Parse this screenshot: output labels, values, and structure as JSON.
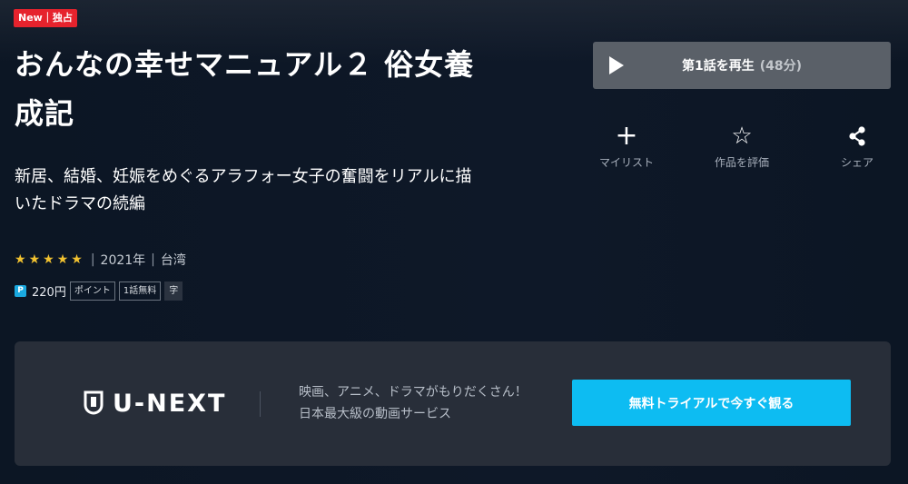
{
  "badge": "New｜独占",
  "title": "おんなの幸せマニュアル２ 俗女養成記",
  "description": "新居、結婚、妊娠をめぐるアラフォー女子の奮闘をリアルに描いたドラマの続編",
  "rating": {
    "stars": 5,
    "max": 5,
    "star_glyph": "★"
  },
  "meta": {
    "year": "2021年",
    "country": "台湾",
    "separator": "|"
  },
  "price": {
    "icon_label": "P",
    "amount": "220円",
    "chips": [
      "ポイント",
      "1話無料",
      "字"
    ]
  },
  "play_button": {
    "label": "第1話を再生",
    "duration": "(48分)",
    "icon": "play-icon"
  },
  "actions": [
    {
      "label": "マイリスト",
      "icon": "plus-icon"
    },
    {
      "label": "作品を評価",
      "icon": "star-outline-icon"
    },
    {
      "label": "シェア",
      "icon": "share-icon"
    }
  ],
  "promo": {
    "logo_text": "U-NEXT",
    "line1": "映画、アニメ、ドラマがもりだくさん！",
    "line2": "日本最大級の動画サービス",
    "cta": "無料トライアルで今すぐ観る"
  },
  "colors": {
    "background": "#0c1624",
    "badge": "#e6232d",
    "star": "#f2c230",
    "cta": "#0dbcf2",
    "play_button": "#5a6068",
    "promo_panel": "#282e39"
  }
}
